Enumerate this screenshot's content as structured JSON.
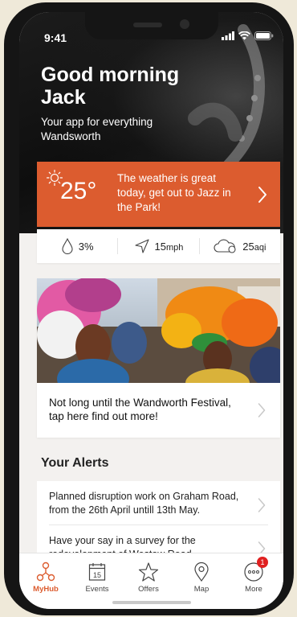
{
  "status_bar": {
    "time": "9:41"
  },
  "hero": {
    "greeting": "Good morning Jack",
    "subtitle": "Your app for everything Wandsworth"
  },
  "weather": {
    "temperature": "25°",
    "message": "The weather is great today, get out to Jazz in the Park!",
    "accent_color": "#dc5c2f"
  },
  "stats": {
    "rain": "3%",
    "wind_value": "15",
    "wind_unit": "mph",
    "aqi_value": "25",
    "aqi_unit": "aqi"
  },
  "festival": {
    "text": "Not long until the Wandworth Festival, tap here find out more!"
  },
  "alerts": {
    "title": "Your Alerts",
    "items": [
      "Planned disruption work on Graham Road, from the 26th April untill 13th May.",
      "Have your say in a survey for the redevelopment of Westow Road"
    ]
  },
  "tabbar": {
    "tabs": [
      {
        "label": "MyHub",
        "icon": "hub-icon",
        "active": true
      },
      {
        "label": "Events",
        "icon": "calendar-icon",
        "day": "15"
      },
      {
        "label": "Offers",
        "icon": "star-icon"
      },
      {
        "label": "Map",
        "icon": "map-pin-icon"
      },
      {
        "label": "More",
        "icon": "more-icon",
        "badge": "1"
      }
    ]
  }
}
